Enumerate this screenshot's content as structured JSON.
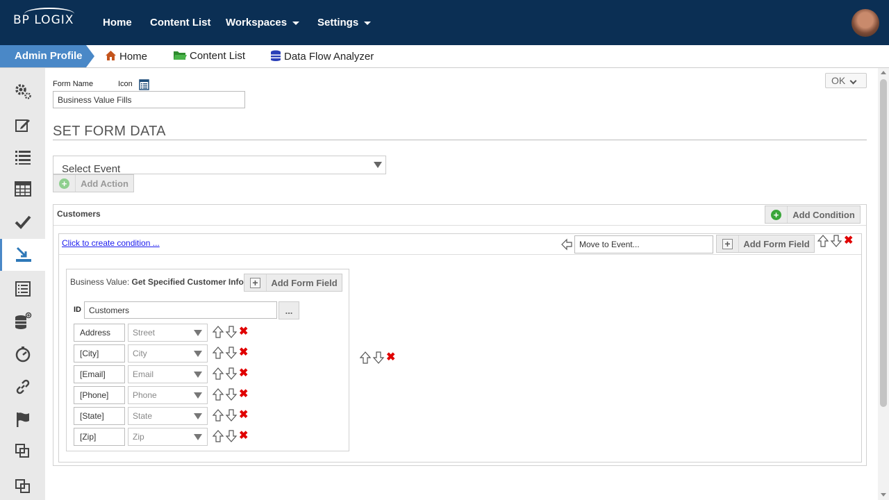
{
  "topbar": {
    "logo": "BP LOGIX",
    "nav": [
      {
        "label": "Home",
        "has_caret": false
      },
      {
        "label": "Content List",
        "has_caret": false
      },
      {
        "label": "Workspaces",
        "has_caret": true
      },
      {
        "label": "Settings",
        "has_caret": true
      }
    ],
    "avatar_icon": "user-avatar"
  },
  "breadcrumb": {
    "active": "Admin Profile",
    "items": [
      {
        "label": "Home",
        "icon": "home-icon"
      },
      {
        "label": "Content List",
        "icon": "folder-icon"
      },
      {
        "label": "Data Flow Analyzer",
        "icon": "database-icon"
      }
    ]
  },
  "sidebar": {
    "items": [
      {
        "icon": "gears-icon"
      },
      {
        "icon": "edit-icon"
      },
      {
        "icon": "list-icon"
      },
      {
        "icon": "table-icon"
      },
      {
        "icon": "check-icon"
      },
      {
        "icon": "import-icon",
        "active": true
      },
      {
        "icon": "document-list-icon"
      },
      {
        "icon": "database-add-icon"
      },
      {
        "icon": "timer-icon"
      },
      {
        "icon": "link-icon"
      },
      {
        "icon": "flag-icon"
      },
      {
        "icon": "copy-icon"
      },
      {
        "icon": "copy-alt-icon"
      }
    ]
  },
  "form": {
    "name_label": "Form Name",
    "icon_label": "Icon",
    "name_value": "Business Value Fills",
    "ok_label": "OK"
  },
  "section": {
    "title": "SET FORM DATA",
    "select_event": "Select Event",
    "add_action": "Add Action"
  },
  "customers_panel": {
    "title": "Customers",
    "add_condition": "Add Condition",
    "condition_link": "Click to create condition ...",
    "move_to_event": "Move to Event...",
    "add_form_field": "Add Form Field"
  },
  "business_value": {
    "label": "Business Value:",
    "name": "Get Specified Customer Info",
    "add_form_field": "Add Form Field",
    "id_label": "ID",
    "id_value": "Customers",
    "browse_label": "...",
    "rows": [
      {
        "field": "Address",
        "column": "Street"
      },
      {
        "field": "[City]",
        "column": "City"
      },
      {
        "field": "[Email]",
        "column": "Email"
      },
      {
        "field": "[Phone]",
        "column": "Phone"
      },
      {
        "field": "[State]",
        "column": "State"
      },
      {
        "field": "[Zip]",
        "column": "Zip"
      }
    ]
  },
  "colors": {
    "navbar": "#0b2f54",
    "accent": "#4a88c7",
    "sidebar": "#e9e9e9",
    "delete": "#e00000",
    "add": "#3aa63a"
  }
}
